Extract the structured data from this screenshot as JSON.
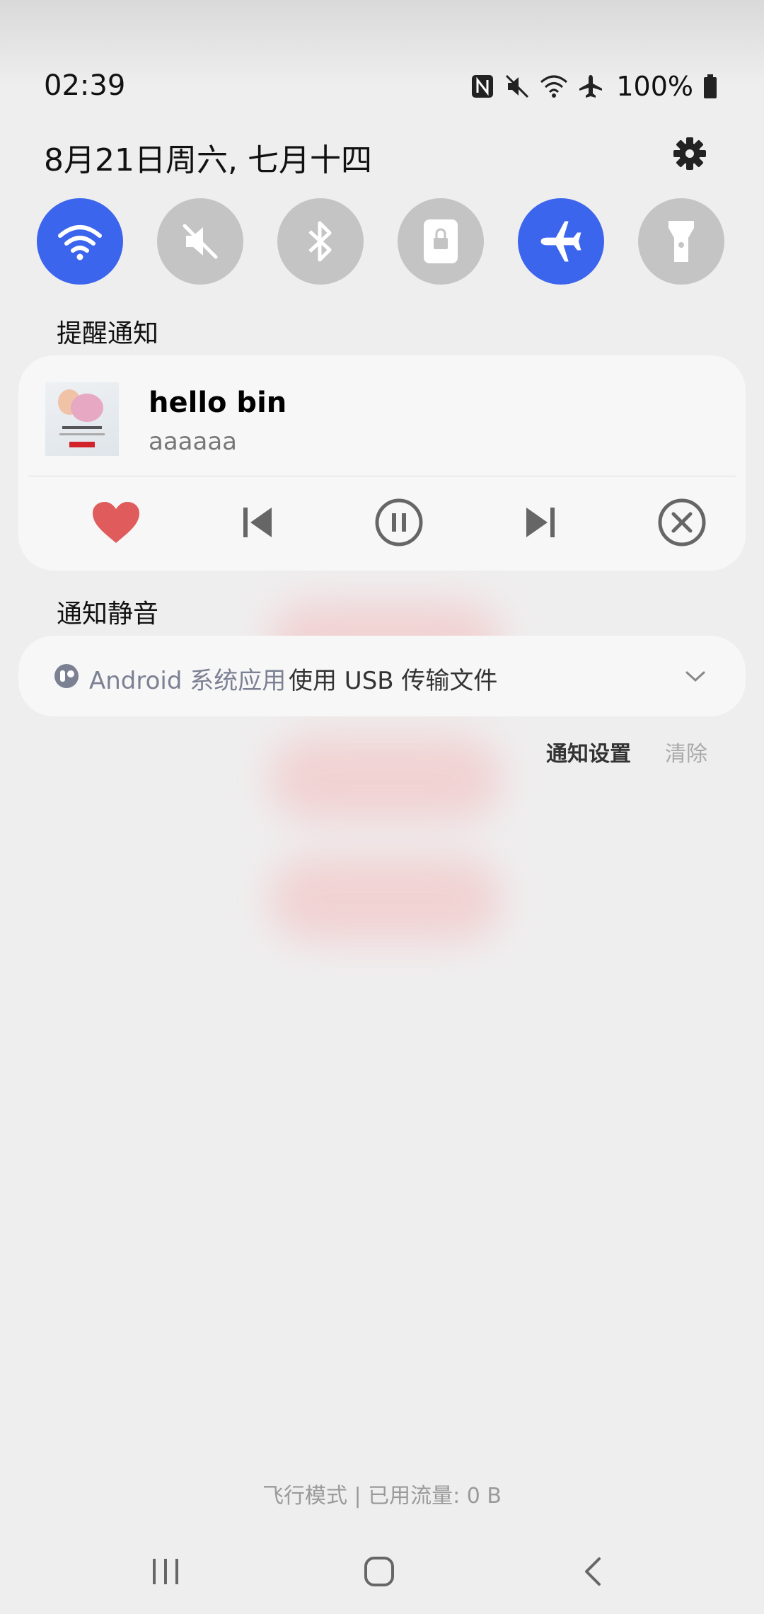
{
  "status_bar": {
    "time": "02:39",
    "battery": "100%",
    "icons": [
      "nfc-icon",
      "mute-icon",
      "wifi-icon",
      "airplane-icon",
      "battery-icon"
    ]
  },
  "header": {
    "date": "8月21日周六, 七月十四",
    "settings_icon": "gear-icon"
  },
  "quick_toggles": [
    {
      "name": "wifi",
      "icon": "wifi-icon",
      "on": true
    },
    {
      "name": "sound",
      "icon": "mute-icon",
      "on": false
    },
    {
      "name": "bluetooth",
      "icon": "bluetooth-icon",
      "on": false
    },
    {
      "name": "rotation-lock",
      "icon": "lock-icon",
      "on": false
    },
    {
      "name": "airplane",
      "icon": "airplane-icon",
      "on": true
    },
    {
      "name": "flashlight",
      "icon": "flashlight-icon",
      "on": false
    }
  ],
  "sections": {
    "alert_label": "提醒通知",
    "silent_label": "通知静音"
  },
  "media_notification": {
    "title": "hello bin",
    "subtitle": "aaaaaa",
    "controls": [
      "heart-icon",
      "previous-icon",
      "pause-icon",
      "next-icon",
      "close-icon"
    ]
  },
  "usb_notification": {
    "app": "Android 系统应用",
    "text": "使用 USB 传输文件"
  },
  "actions": {
    "settings_label": "通知设置",
    "clear_label": "清除"
  },
  "footer": {
    "status": "飞行模式 | 已用流量: 0 B"
  },
  "colors": {
    "accent": "#3b65ed",
    "toggle_off": "#c4c4c4",
    "heart": "#e05c5c"
  }
}
